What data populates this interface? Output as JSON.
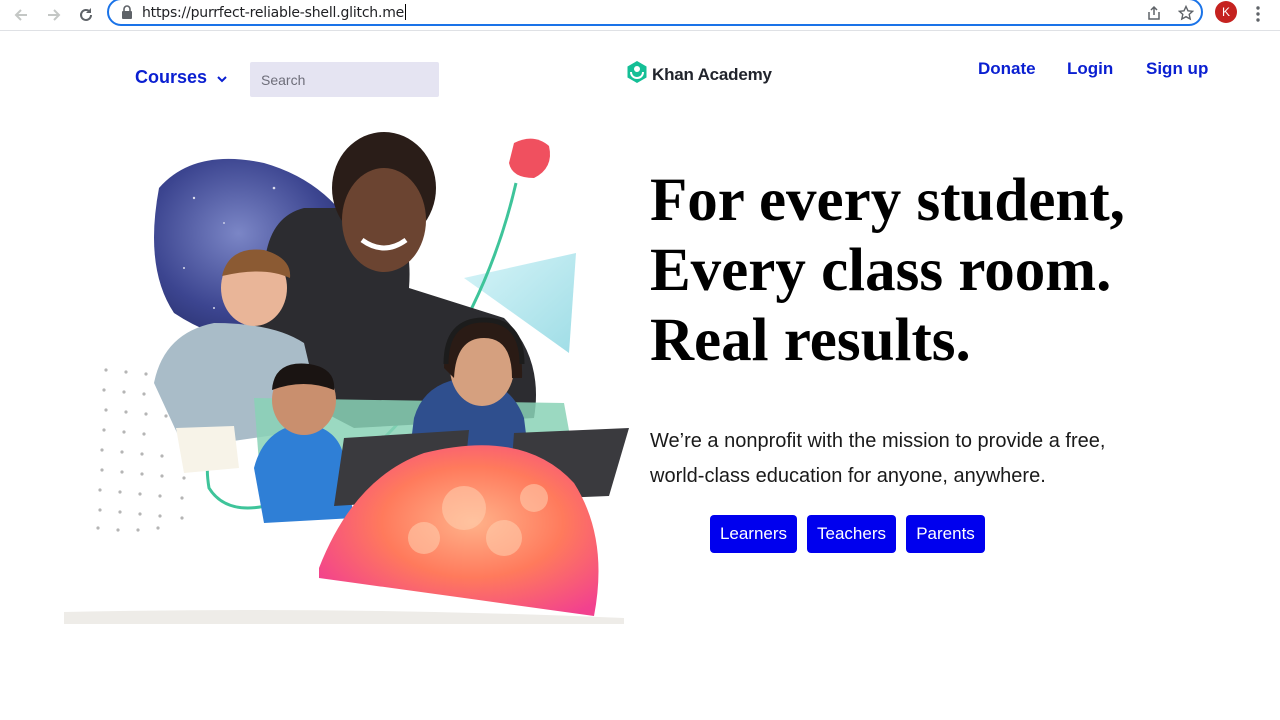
{
  "browser": {
    "url": "https://purrfect-reliable-shell.glitch.me",
    "profile_initial": "K",
    "icons": [
      "back-arrow-icon",
      "forward-arrow-icon",
      "reload-icon",
      "lock-icon",
      "share-icon",
      "star-icon",
      "menu-dots-icon"
    ]
  },
  "header": {
    "courses_label": "Courses",
    "search_placeholder": "Search",
    "logo_text": "Khan Academy",
    "nav": {
      "donate": "Donate",
      "login": "Login",
      "signup": "Sign up"
    }
  },
  "hero": {
    "headline": [
      "For every student,",
      "Every class room.",
      "Real results."
    ],
    "mission_line1": "We’re a nonprofit with the mission to provide a free,",
    "mission_line2": "world-class education for anyone, anywhere.",
    "buttons": {
      "learners": "Learners",
      "teachers": "Teachers",
      "parents": "Parents"
    }
  },
  "colors": {
    "link_blue": "#0a1fd1",
    "button_blue": "#0000ee",
    "search_bg": "#e5e4f2",
    "logo_green": "#14bf96",
    "omnibox_focus": "#1a73e8"
  }
}
